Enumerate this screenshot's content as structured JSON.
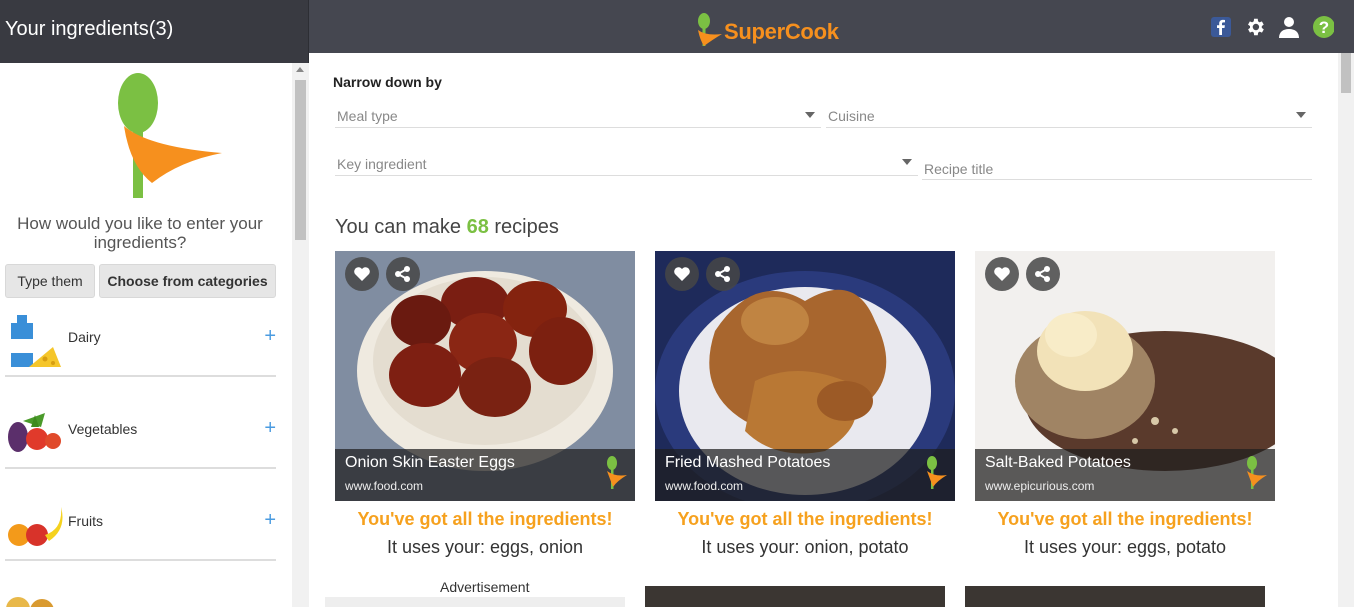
{
  "sidebar": {
    "title": "Your ingredients(3)",
    "question": "How would you like to enter your ingredients?",
    "type_button": "Type them",
    "categories_button": "Choose from categories",
    "categories": [
      {
        "label": "Dairy",
        "icon": "dairy-icon"
      },
      {
        "label": "Vegetables",
        "icon": "vegetables-icon"
      },
      {
        "label": "Fruits",
        "icon": "fruits-icon"
      }
    ],
    "plus": "+"
  },
  "header": {
    "brand": "SuperCook",
    "icons": [
      "facebook-icon",
      "gear-icon",
      "user-icon",
      "help-icon"
    ],
    "accent": "#7bc043",
    "brand_orange": "#f6901e"
  },
  "filters": {
    "narrow_label": "Narrow down by",
    "meal_type": "Meal type",
    "cuisine": "Cuisine",
    "key_ingredient": "Key ingredient",
    "recipe_title": "Recipe title"
  },
  "results": {
    "prefix": "You can make",
    "count": "68",
    "suffix": "recipes",
    "cards": [
      {
        "title": "Onion Skin Easter Eggs",
        "source": "www.food.com",
        "status": "You've got all the ingredients!",
        "uses": "It uses your: eggs, onion"
      },
      {
        "title": "Fried Mashed Potatoes",
        "source": "www.food.com",
        "status": "You've got all the ingredients!",
        "uses": "It uses your: onion, potato"
      },
      {
        "title": "Salt-Baked Potatoes",
        "source": "www.epicurious.com",
        "status": "You've got all the ingredients!",
        "uses": "It uses your: eggs, potato"
      }
    ],
    "advertisement": "Advertisement"
  }
}
